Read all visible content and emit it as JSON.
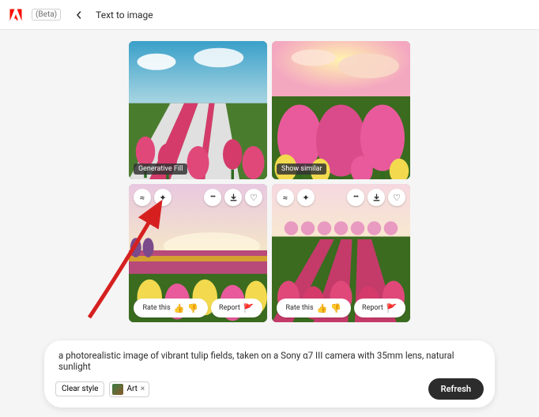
{
  "header": {
    "beta_label": "(Beta)",
    "crumb": "Text to image"
  },
  "tiles": {
    "t1_label": "Generative Fill",
    "t2_label": "Show similar",
    "rate_label": "Rate this",
    "report_label": "Report",
    "thumbs_up": "👍",
    "thumbs_down": "👎",
    "flag": "🚩",
    "icon_similar": "≈",
    "icon_edit": "✦",
    "icon_more": "•••",
    "icon_download": "↓",
    "icon_fav": "♡"
  },
  "prompt": {
    "text": "a photorealistic image of vibrant tulip fields, taken on a Sony α7 III camera with 35mm lens, natural sunlight",
    "clear_style": "Clear style",
    "style_chip": "Art",
    "style_x": "×",
    "refresh": "Refresh"
  }
}
